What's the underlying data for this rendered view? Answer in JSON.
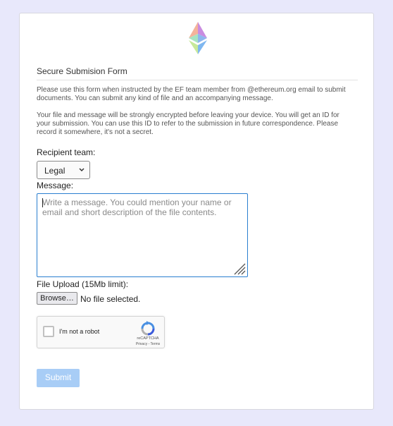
{
  "form": {
    "title": "Secure Submision Form",
    "intro_1": "Please use this form when instructed by the EF team member from @ethereum.org email to submit documents. You can submit any kind of file and an accompanying message.",
    "intro_2": "Your file and message will be strongly encrypted before leaving your device. You will get an ID for your submission. You can use this ID to refer to the submission in future correspondence. Please record it somewhere, it's not a secret.",
    "recipient_label": "Recipient team:",
    "recipient_selected": "Legal",
    "message_label": "Message:",
    "message_placeholder": "Write a message. You could mention your name or email and short description of the file contents.",
    "file_label": "File Upload (15Mb limit):",
    "browse_label": "Browse…",
    "no_file_text": "No file selected.",
    "submit_label": "Submit"
  },
  "captcha": {
    "checkbox_label": "I'm not a robot",
    "brand": "reCAPTCHA",
    "links": "Privacy - Terms"
  },
  "icons": {
    "logo": "ethereum-logo-icon",
    "dropdown": "chevron-down-icon",
    "resize": "resize-grip-icon",
    "recaptcha": "recaptcha-icon"
  },
  "colors": {
    "page_bg": "#e8e8fb",
    "focus_border": "#2a7fd0",
    "submit_bg": "#a8cdf6"
  }
}
